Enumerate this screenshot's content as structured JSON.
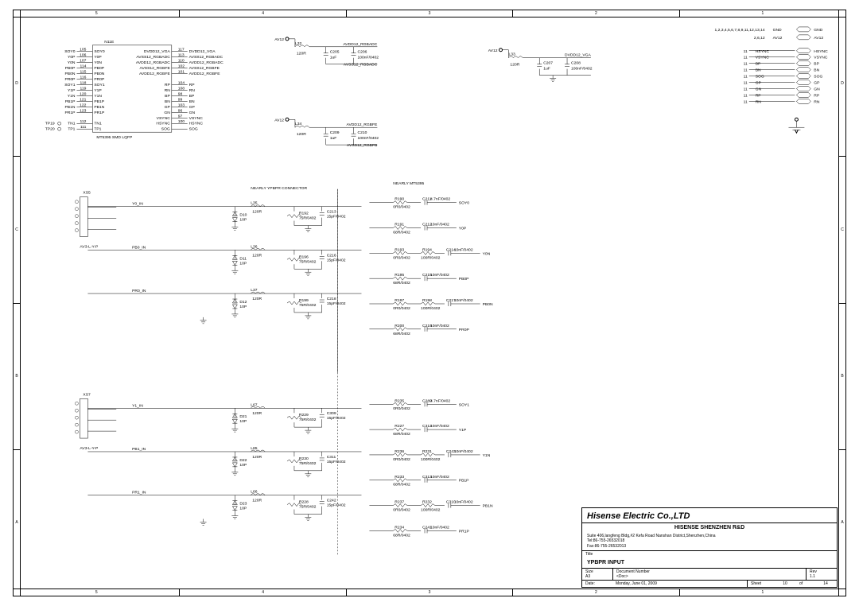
{
  "ruler_cols": [
    "5",
    "4",
    "3",
    "2",
    "1"
  ],
  "ruler_rows": [
    "D",
    "C",
    "B",
    "A"
  ],
  "title_block": {
    "company": "Hisense Electric Co.,LTD",
    "dept": "HISENSE SHENZHEN R&D",
    "addr1": "Suite 406,langfeng Bldg,#2 Kefa Road Nanshan District,Shenzhen,China",
    "addr2": "Tel:86-755-26532018",
    "addr3": "Fax:86-755-26532013",
    "title_lbl": "Title",
    "title": "YPBPR INPUT",
    "size_lbl": "Size",
    "size": "A3",
    "doc_lbl": "Document Number",
    "doc": "<Doc>",
    "rev_lbl": "Rev",
    "rev": "1.1",
    "date_lbl": "Date:",
    "date": "Monday, June 01, 2009",
    "sheet_lbl": "Sheet",
    "sheet": "10",
    "of": "of",
    "total": "14"
  },
  "chip": {
    "ref": "N11E",
    "part": "MT5395 SMD LQFP",
    "left_sig": [
      "SOY0",
      "Y0P",
      "Y0N",
      "PB0P",
      "PB0N",
      "PR0P",
      "SOY1",
      "Y1P",
      "Y1N",
      "PB1P",
      "PB1N",
      "PR1P",
      "",
      "TN1",
      "TP1"
    ],
    "left_pin": [
      "105",
      "106",
      "107",
      "114",
      "115",
      "116",
      "118",
      "119",
      "120",
      "121",
      "122",
      "123",
      "",
      "112",
      "111"
    ],
    "left_lbl": [
      "SOY0",
      "Y0P",
      "Y0N",
      "PB0P",
      "PB0N",
      "PR0P",
      "SOY1",
      "Y1P",
      "Y1N",
      "PB1P",
      "PB1N",
      "PR1P",
      "",
      "TN1",
      "TP1"
    ],
    "left_tp": [
      "TP19",
      "TP20"
    ],
    "right_sig": [
      "DVDD12_VGA",
      "AVSS12_RGBADC",
      "AVDD12_RGBADC",
      "AVSS12_RGBFE",
      "AVDD12_RGBFE",
      "",
      "RP",
      "RN",
      "BP",
      "BN",
      "GP",
      "GN",
      "VSYNC",
      "HSYNC",
      "SOG"
    ],
    "right_pin": [
      "117",
      "113",
      "110",
      "102",
      "101",
      "",
      "104",
      "108",
      "98",
      "99",
      "103",
      "96",
      "97",
      "100"
    ],
    "right_lbl": [
      "DVDD12_VGA",
      "AVSS12_RGBADC",
      "AVDD12_RGBADC",
      "AVSS12_RGBFE",
      "AVDD12_RGBFE",
      "",
      "RP",
      "RN",
      "BP",
      "BN",
      "GP",
      "GN",
      "VSYNC",
      "HSYNC",
      "SOG"
    ]
  },
  "gnd_note": {
    "pins": "1,2,3,4,5,6,7,8,9,11,12,13,14",
    "sig": "GND",
    "port": "GND",
    "pins2": "2,6,12",
    "sig2": "AV12",
    "port2": "AV12"
  },
  "pin11_block": {
    "pin": "11",
    "sigs": [
      "HSYNC",
      "VSYNC",
      "BP",
      "BN",
      "SOG",
      "GP",
      "GN",
      "RP",
      "RN"
    ],
    "ports": [
      "HSYNC",
      "VSYNC",
      "BP",
      "BN",
      "SOG",
      "GP",
      "GN",
      "RP",
      "RN"
    ]
  },
  "decouple": [
    {
      "av": "AV12",
      "L": "L32",
      "Lval": "120R",
      "C1": "C205",
      "C1v": "1uF",
      "C2": "C206",
      "C2v": "100nF/0402",
      "top": "AVDD12_RGBADC",
      "bot": "AVSS12_RGBADC"
    },
    {
      "av": "AV12",
      "L": "L33",
      "Lval": "120R",
      "C1": "C207",
      "C1v": "1uF",
      "C2": "C208",
      "C2v": "100nF/0402",
      "top": "DVDD12_VGA",
      "bot": ""
    },
    {
      "av": "AV12",
      "L": "L34",
      "Lval": "120R",
      "C1": "C209",
      "C1v": "1uF",
      "C2": "C210",
      "C2v": "100nF/0402",
      "top": "AVDD12_RGBFE",
      "bot": "AVSS12_RGBFB"
    }
  ],
  "sec_notes": {
    "a": "NEARLY YPBPR CONNECTOR",
    "b": "NEARLY MT5395"
  },
  "xs5": {
    "ref": "XS5",
    "conn": "AV3-L-Y-P",
    "ins": [
      "Y0_IN",
      "PB0_IN",
      "PR0_IN"
    ],
    "Ls": [
      {
        "r": "L35",
        "v": "120R"
      },
      {
        "r": "L36",
        "v": "120R"
      },
      {
        "r": "L37",
        "v": "120R"
      }
    ],
    "Ds": [
      {
        "r": "D10",
        "v": "10P"
      },
      {
        "r": "D11",
        "v": "10P"
      },
      {
        "r": "D12",
        "v": "10P"
      }
    ],
    "Rs": [
      {
        "r": "R192",
        "v": "75R/0402"
      },
      {
        "r": "R196",
        "v": "75R/0402"
      },
      {
        "r": "R199",
        "v": "75R/0402"
      }
    ],
    "Cs": [
      {
        "r": "C213",
        "v": "15pF/0402"
      },
      {
        "r": "C216",
        "v": "15pF/0402"
      },
      {
        "r": "C218",
        "v": "15pF/0402"
      }
    ],
    "outs": [
      {
        "R": "R190",
        "Rv": "0R0/0402",
        "C": "C211",
        "Cv": "4.7nF/0402",
        "sig": "SOY0"
      },
      {
        "R": "R191",
        "Rv": "68R/0402",
        "C": "C212",
        "Cv": "10nF/0402",
        "sig": "Y0P"
      },
      {
        "R": "R193",
        "Rv": "0R0/0402",
        "R2": "R194",
        "R2v": "100R/0402",
        "C": "C214",
        "Cv": "10nF/0402",
        "sig": "Y0N"
      },
      {
        "R": "R195",
        "Rv": "68R/0402",
        "C": "C215",
        "Cv": "10nF/0402",
        "sig": "PB0P"
      },
      {
        "R": "R197",
        "Rv": "0R0/0402",
        "R2": "R198",
        "R2v": "100R/0402",
        "C": "C217",
        "Cv": "10nF/0402",
        "sig": "PB0N"
      },
      {
        "R": "R200",
        "Rv": "68R/0402",
        "C": "C219",
        "Cv": "10nF/0402",
        "sig": "PR0P"
      }
    ]
  },
  "xs7": {
    "ref": "XS7",
    "conn": "AV3-L-Y-P",
    "ins": [
      "Y1_IN",
      "PB1_IN",
      "PR1_IN"
    ],
    "Ls": [
      {
        "r": "L67",
        "v": "120R"
      },
      {
        "r": "L65",
        "v": "120R"
      },
      {
        "r": "L66",
        "v": "120R"
      }
    ],
    "Ds": [
      {
        "r": "D21",
        "v": "10P"
      },
      {
        "r": "D22",
        "v": "10P"
      },
      {
        "r": "D23",
        "v": "10P"
      }
    ],
    "Rs": [
      {
        "r": "R229",
        "v": "75R/0402"
      },
      {
        "r": "R230",
        "v": "75R/0402"
      },
      {
        "r": "R228",
        "v": "75R/0402"
      }
    ],
    "Cs": [
      {
        "r": "C309",
        "v": "15pF/0402"
      },
      {
        "r": "C311",
        "v": "15pF/0402"
      },
      {
        "r": "C242",
        "v": "15pF/0402"
      }
    ],
    "outs": [
      {
        "R": "R235",
        "Rv": "0R0/0402",
        "C": "C280",
        "Cv": "4.7nF/0402",
        "sig": "SOY1"
      },
      {
        "R": "R227",
        "Rv": "68R/0402",
        "C": "C312",
        "Cv": "10nF/0402",
        "sig": "Y1P"
      },
      {
        "R": "R236",
        "Rv": "0R0/0402",
        "R2": "R231",
        "R2v": "100R/0402",
        "C": "C243",
        "Cv": "10nF/0402",
        "sig": "Y1N"
      },
      {
        "R": "R233",
        "Rv": "68R/0402",
        "C": "C313",
        "Cv": "10nF/0402",
        "sig": "PB1P"
      },
      {
        "R": "R237",
        "Rv": "0R0/0402",
        "R2": "R232",
        "R2v": "100R/0402",
        "C": "C310",
        "Cv": "10nF/0402",
        "sig": "PB1N"
      },
      {
        "R": "R234",
        "Rv": "68R/0402",
        "C": "C241",
        "Cv": "10nF/0402",
        "sig": "PR1P"
      }
    ]
  }
}
